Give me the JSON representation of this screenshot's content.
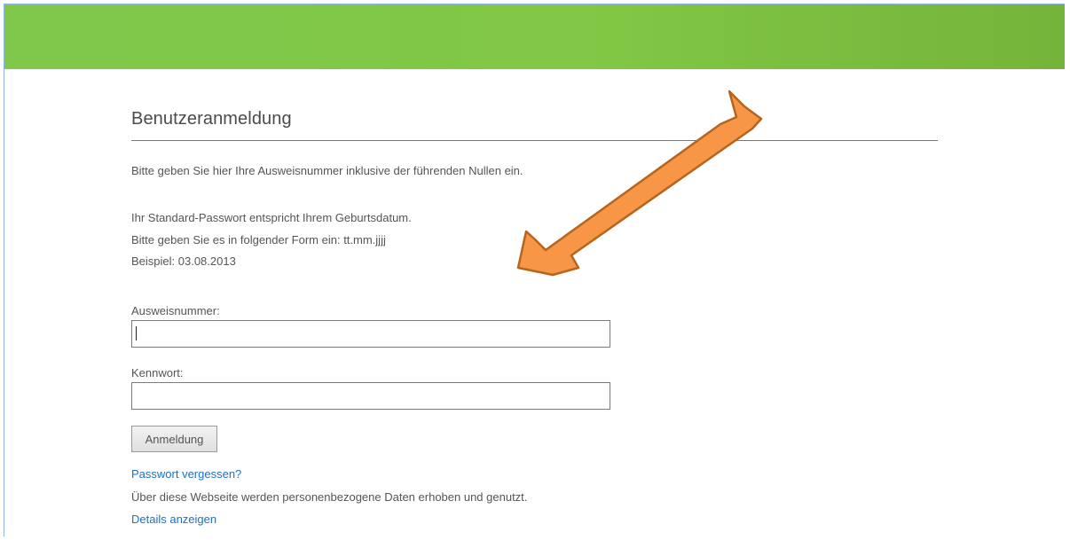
{
  "login": {
    "title": "Benutzeranmeldung",
    "intro": "Bitte geben Sie hier Ihre Ausweisnummer inklusive der führenden Nullen ein.",
    "password_info": [
      "Ihr Standard-Passwort entspricht Ihrem Geburtsdatum.",
      "Bitte geben Sie es in folgender Form ein: tt.mm.jjjj",
      "Beispiel: 03.08.2013"
    ],
    "id_label": "Ausweisnummer:",
    "id_value": "",
    "password_label": "Kennwort:",
    "password_value": "",
    "submit_label": "Anmeldung",
    "forgot_link": "Passwort vergessen?",
    "privacy_text": "Über diese Webseite werden personenbezogene Daten erhoben und genutzt.",
    "details_link": "Details anzeigen"
  },
  "colors": {
    "header_green": "#82c745",
    "link_blue": "#1f6fc5",
    "arrow_orange": "#f79646",
    "arrow_outline": "#b5651d"
  },
  "annotation": {
    "arrow_icon": "arrow-down-left-icon"
  }
}
